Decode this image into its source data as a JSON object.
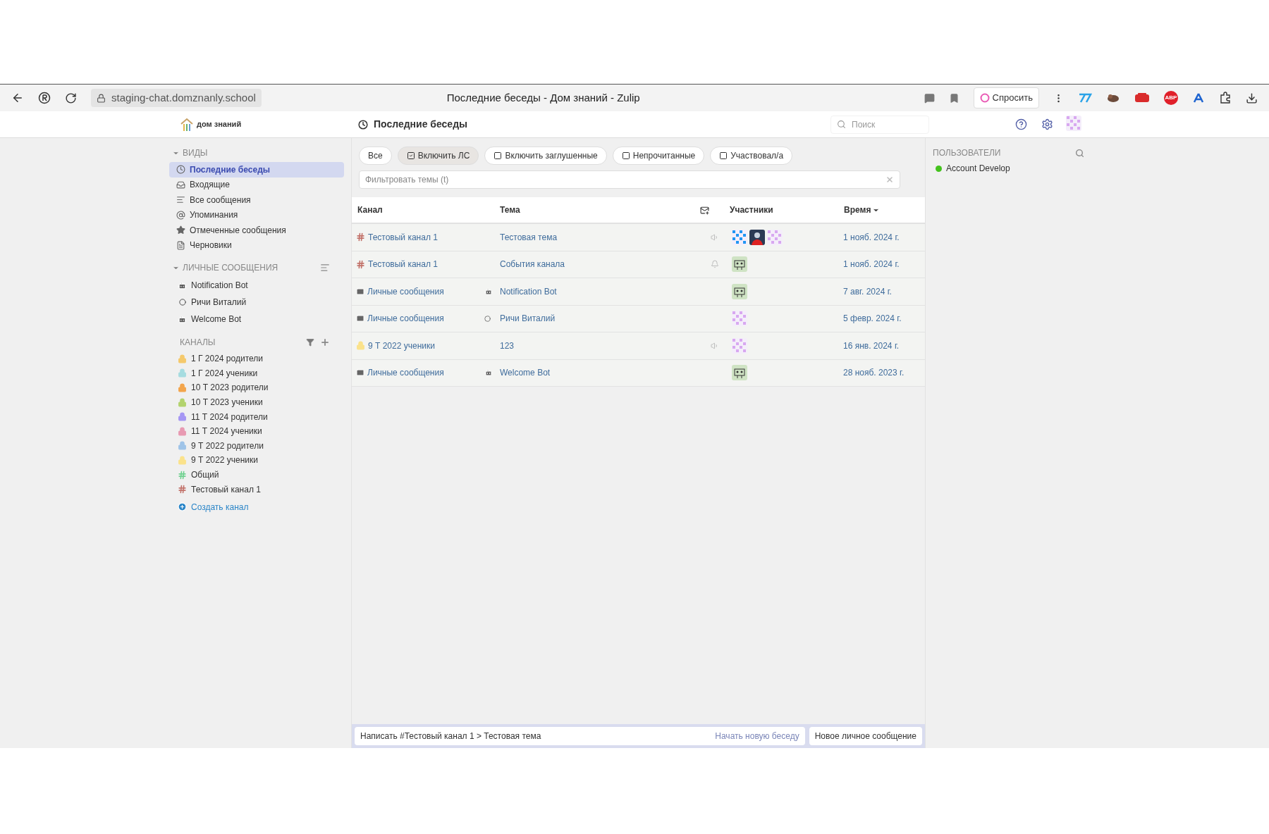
{
  "browser": {
    "url": "staging-chat.domznanly.school",
    "title": "Последние беседы - Дом знаний - Zulip",
    "ask_button": "Спросить",
    "extension_badge": "ABP"
  },
  "header": {
    "logo_text": "дом знаний",
    "view_title": "Последние беседы",
    "search_placeholder": "Поиск"
  },
  "sidebar": {
    "views": {
      "title": "ВИДЫ",
      "expanded": true,
      "items": [
        {
          "label": "Последние беседы",
          "kind": "recent",
          "selected": true
        },
        {
          "label": "Входящие",
          "kind": "inbox",
          "selected": false
        },
        {
          "label": "Все сообщения",
          "kind": "all",
          "selected": false
        },
        {
          "label": "Упоминания",
          "kind": "mentions",
          "selected": false
        },
        {
          "label": "Отмеченные сообщения",
          "kind": "starred",
          "selected": false
        },
        {
          "label": "Черновики",
          "kind": "drafts",
          "selected": false
        }
      ]
    },
    "dms": {
      "title": "ЛИЧНЫЕ СООБЩЕНИЯ",
      "expanded": true,
      "items": [
        {
          "label": "Notification Bot",
          "kind": "bot"
        },
        {
          "label": "Ричи Виталий",
          "kind": "user"
        },
        {
          "label": "Welcome Bot",
          "kind": "bot"
        }
      ]
    },
    "channels": {
      "title": "КАНАЛЫ",
      "items": [
        {
          "label": "1 Г 2024 родители",
          "kind": "private",
          "color": "#f5c96b"
        },
        {
          "label": "1 Г 2024 ученики",
          "kind": "private",
          "color": "#a6dce0"
        },
        {
          "label": "10 Т 2023 родители",
          "kind": "private",
          "color": "#f3a54c"
        },
        {
          "label": "10 Т 2023 ученики",
          "kind": "private",
          "color": "#b3d36e"
        },
        {
          "label": "11 Т 2024 родители",
          "kind": "private",
          "color": "#a697f4"
        },
        {
          "label": "11 Т 2024 ученики",
          "kind": "private",
          "color": "#e89ab2"
        },
        {
          "label": "9 Т 2022 родители",
          "kind": "private",
          "color": "#9fc4e8"
        },
        {
          "label": "9 Т 2022 ученики",
          "kind": "private",
          "color": "#fbe28b"
        },
        {
          "label": "Общий",
          "kind": "public",
          "color": "#6fd18f"
        },
        {
          "label": "Тестовый канал 1",
          "kind": "public",
          "color": "#c2726a"
        }
      ]
    },
    "create_channel": "Создать канал"
  },
  "filters": [
    {
      "label": "Все",
      "kind": "plain",
      "selected": false
    },
    {
      "label": "Включить ЛС",
      "kind": "checkbox",
      "selected": true,
      "checked": true
    },
    {
      "label": "Включить заглушенные",
      "kind": "checkbox",
      "selected": false,
      "checked": false
    },
    {
      "label": "Непрочитанные",
      "kind": "checkbox",
      "selected": false,
      "checked": false
    },
    {
      "label": "Участвовал/а",
      "kind": "checkbox",
      "selected": false,
      "checked": false
    }
  ],
  "topic_filter": {
    "placeholder": "Фильтровать темы (t)"
  },
  "table": {
    "columns": [
      "Канал",
      "Тема",
      "Участники",
      "Время"
    ],
    "rows": [
      {
        "channel": {
          "label": "Тестовый канал 1",
          "kind": "public",
          "color": "#c2726a"
        },
        "topic": {
          "label": "Тестовая тема"
        },
        "notify": {
          "kind": "unmute"
        },
        "participants": [
          {
            "kind": "blue"
          },
          {
            "kind": "person"
          },
          {
            "kind": "purple"
          }
        ],
        "time": "1 нояб. 2024 г."
      },
      {
        "channel": {
          "label": "Тестовый канал 1",
          "kind": "public",
          "color": "#c2726a"
        },
        "topic": {
          "label": "События канала"
        },
        "notify": {
          "kind": "bell"
        },
        "participants": [
          {
            "kind": "bot"
          }
        ],
        "time": "1 нояб. 2024 г."
      },
      {
        "channel": {
          "label": "Личные сообщения",
          "kind": "dm"
        },
        "topic": {
          "label": "Notification Bot",
          "kind": "bot"
        },
        "participants": [
          {
            "kind": "bot"
          }
        ],
        "time": "7 авг. 2024 г."
      },
      {
        "channel": {
          "label": "Личные сообщения",
          "kind": "dm"
        },
        "topic": {
          "label": "Ричи Виталий",
          "kind": "user"
        },
        "participants": [
          {
            "kind": "purple"
          }
        ],
        "time": "5 февр. 2024 г."
      },
      {
        "channel": {
          "label": "9 Т 2022 ученики",
          "kind": "private",
          "color": "#fbe28b"
        },
        "topic": {
          "label": "123"
        },
        "notify": {
          "kind": "unmute"
        },
        "participants": [
          {
            "kind": "purple"
          }
        ],
        "time": "16 янв. 2024 г."
      },
      {
        "channel": {
          "label": "Личные сообщения",
          "kind": "dm"
        },
        "topic": {
          "label": "Welcome Bot",
          "kind": "bot"
        },
        "participants": [
          {
            "kind": "bot"
          }
        ],
        "time": "28 нояб. 2023 г."
      }
    ]
  },
  "compose": {
    "reply": "Написать #Тестовый канал 1 > Тестовая тема",
    "new_topic": "Начать новую беседу",
    "new_dm": "Новое личное сообщение"
  },
  "users": {
    "title": "ПОЛЬЗОВАТЕЛИ",
    "items": [
      {
        "name": "Account Develop",
        "color": "#44c21d"
      }
    ]
  }
}
